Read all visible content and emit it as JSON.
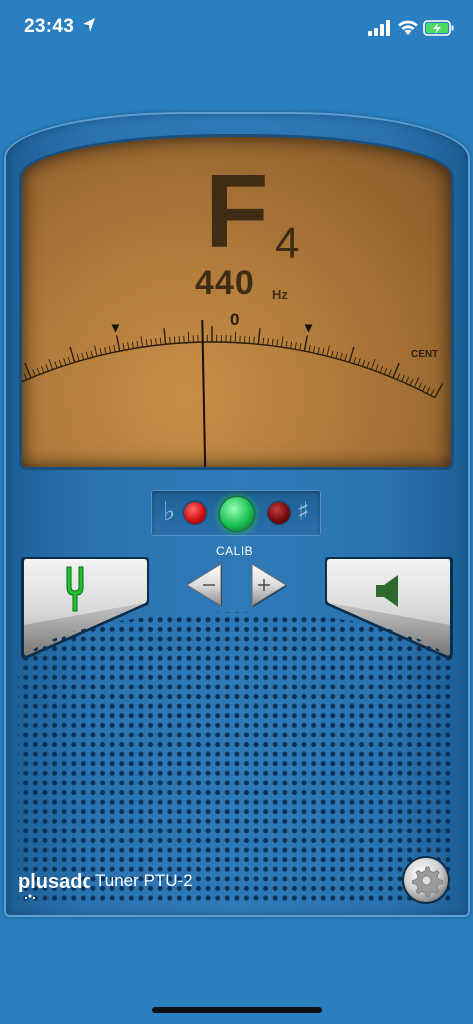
{
  "status_bar": {
    "time": "23:43"
  },
  "meter": {
    "note": "F",
    "octave": "4",
    "frequency": "440",
    "frequency_unit": "Hz",
    "scale_center": "0",
    "scale_min": "-50",
    "scale_max": "+50",
    "scale_unit": "CENT",
    "needle_cents": -2
  },
  "indicator": {
    "flat_symbol": "♭",
    "sharp_symbol": "♯"
  },
  "calib": {
    "label": "CALIB"
  },
  "footer": {
    "brand": "plusadd",
    "model": "Tuner PTU-2"
  },
  "colors": {
    "background": "#2a7fc0",
    "meter": "#b07a3a",
    "led_green": "#18c050",
    "led_red": "#d01010",
    "fork_green": "#22c030",
    "speaker_green": "#2e6a2e"
  },
  "icons": [
    "location-arrow-icon",
    "cellular-signal-icon",
    "wifi-icon",
    "battery-charging-icon",
    "tuning-fork-icon",
    "speaker-icon",
    "arrow-left-icon",
    "arrow-right-icon",
    "gear-icon"
  ]
}
